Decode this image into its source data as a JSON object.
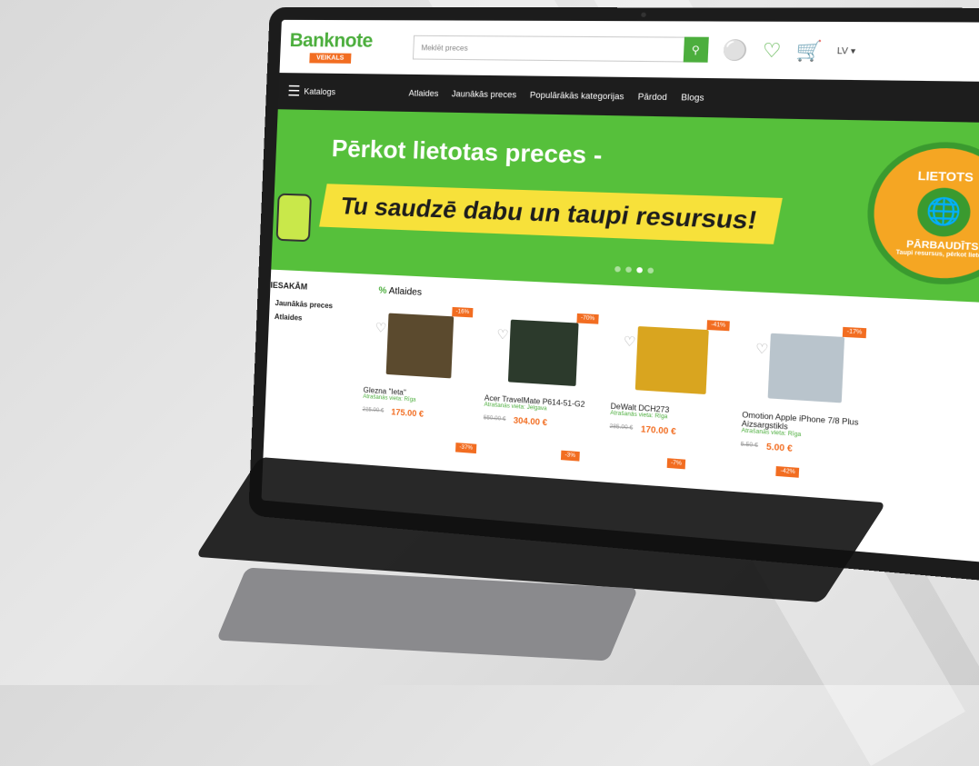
{
  "site": {
    "logo_main": "Banknote",
    "logo_sub": "VEIKALS",
    "search_placeholder": "Meklēt preces",
    "lang": "LV ▾",
    "icons": [
      "search-icon",
      "user-icon",
      "heart-icon",
      "cart-icon"
    ],
    "cart_count": "0"
  },
  "nav": {
    "catalog": "Katalogs",
    "items": [
      "Atlaides",
      "Jaunākās preces",
      "Populārākās kategorijas",
      "Pārdod",
      "Blogs"
    ]
  },
  "banner": {
    "title": "Pērkot lietotas preces -",
    "strip": "Tu saudzē dabu un taupi resursus!",
    "badge_top": "LIETOTS",
    "badge_bottom": "PĀRBAUDĪTS",
    "badge_small": "Taupi resursus, pērkot lietotu"
  },
  "sidebar": {
    "heading": "IESAKĀM",
    "items": [
      "Jaunākās preces",
      "Atlaides"
    ]
  },
  "section": {
    "icon": "%",
    "title": "Atlaides"
  },
  "products": [
    {
      "name": "Glezna \"Ieta\"",
      "avail_label": "Atrašanās vieta:",
      "avail": "Rīga",
      "old": "215.00 €",
      "new": "175.00 €",
      "disc": "-16%",
      "color": "#5b4a2e"
    },
    {
      "name": "Acer TravelMate P614-51-G2",
      "avail_label": "Atrašanās vieta:",
      "avail": "Jelgava",
      "old": "550.00 €",
      "new": "304.00 €",
      "disc": "-70%",
      "color": "#2c3a2c"
    },
    {
      "name": "DeWalt DCH273",
      "avail_label": "Atrašanās vieta:",
      "avail": "Rīga",
      "old": "285.00 €",
      "new": "170.00 €",
      "disc": "-41%",
      "color": "#d9a51f"
    },
    {
      "name": "Omotion Apple iPhone 7/8 Plus Aizsargstikls",
      "avail_label": "Atrašanās vieta:",
      "avail": "Rīga",
      "old": "5.50 €",
      "new": "5.00 €",
      "disc": "-17%",
      "color": "#b9c4cc"
    }
  ],
  "row2_discounts": [
    "-37%",
    "-3%",
    "-7%",
    "-42%"
  ]
}
